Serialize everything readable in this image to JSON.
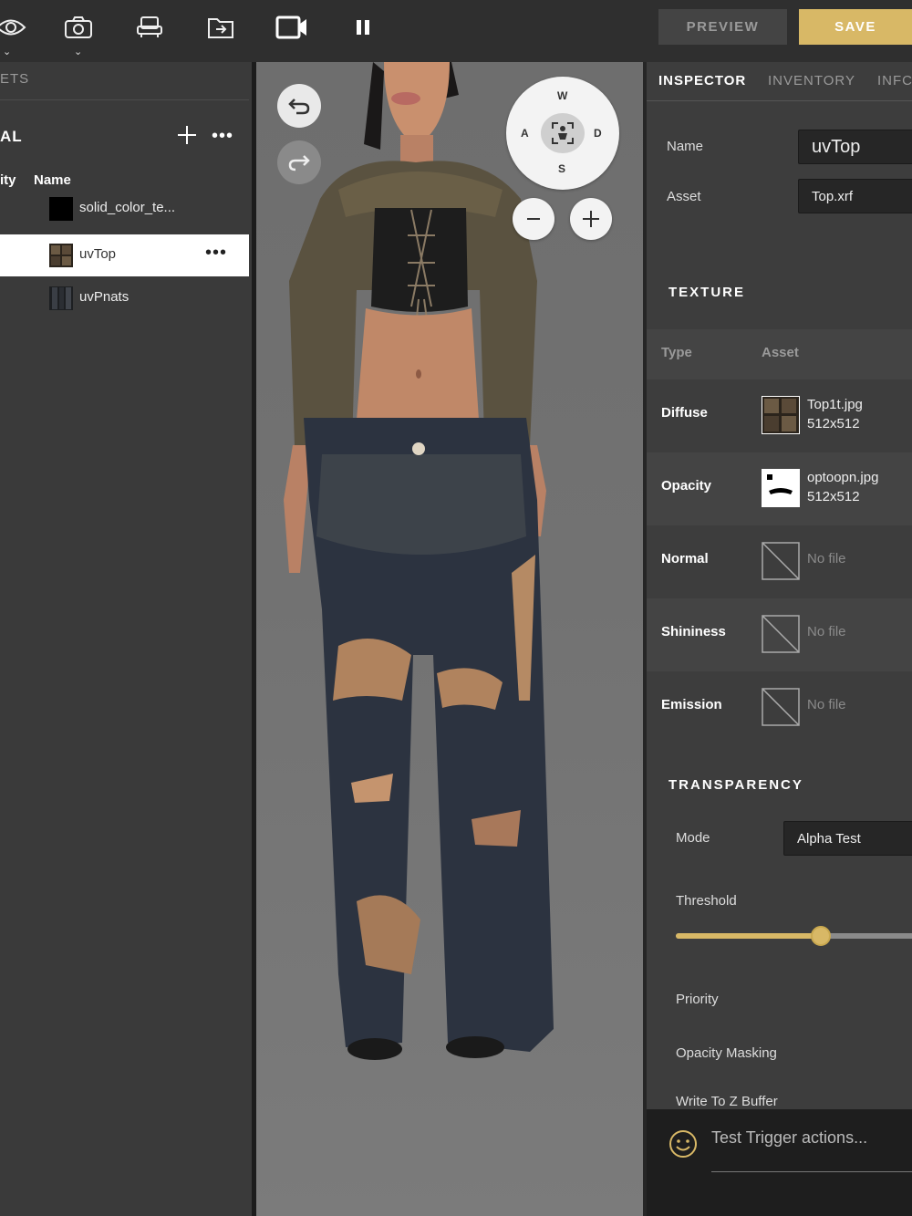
{
  "toolbar": {
    "icons": [
      "eye-icon",
      "camera-icon",
      "chair-icon",
      "export-folder-icon",
      "video-camera-icon",
      "pause-icon"
    ],
    "chevrons": [
      "⌄",
      "⌄"
    ],
    "preview_label": "PREVIEW",
    "save_label": "SAVE",
    "accent_color": "#d8b866"
  },
  "left_panel": {
    "tab_label": "ETS",
    "section_title": "AL",
    "columns": [
      "ity",
      "Name"
    ],
    "items": [
      {
        "label": "solid_color_te...",
        "thumb": "black-swatch",
        "selected": false
      },
      {
        "label": "uvTop",
        "thumb": "top-texture",
        "selected": true,
        "menu": "•••"
      },
      {
        "label": "uvPnats",
        "thumb": "pants-texture",
        "selected": false
      }
    ]
  },
  "viewport": {
    "nav": {
      "w": "W",
      "a": "A",
      "s": "S",
      "d": "D"
    },
    "zoom_out": "−",
    "zoom_in": "+"
  },
  "inspector": {
    "tabs": [
      "INSPECTOR",
      "INVENTORY",
      "INFC"
    ],
    "active_tab": "INSPECTOR",
    "name_label": "Name",
    "name_value": "uvTop",
    "asset_label": "Asset",
    "asset_value": "Top.xrf",
    "texture_heading": "TEXTURE",
    "texture_columns": [
      "Type",
      "Asset"
    ],
    "textures": [
      {
        "type": "Diffuse",
        "file": "Top1t.jpg",
        "size": "512x512"
      },
      {
        "type": "Opacity",
        "file": "optoopn.jpg",
        "size": "512x512"
      },
      {
        "type": "Normal",
        "file": "No file"
      },
      {
        "type": "Shininess",
        "file": "No file"
      },
      {
        "type": "Emission",
        "file": "No file"
      }
    ],
    "transparency_heading": "TRANSPARENCY",
    "mode_label": "Mode",
    "mode_value": "Alpha Test",
    "threshold_label": "Threshold",
    "threshold_value": 0.59,
    "priority_label": "Priority",
    "opacity_masking_label": "Opacity Masking",
    "write_z_label": "Write To Z Buffer",
    "chat_placeholder": "Test Trigger actions..."
  }
}
